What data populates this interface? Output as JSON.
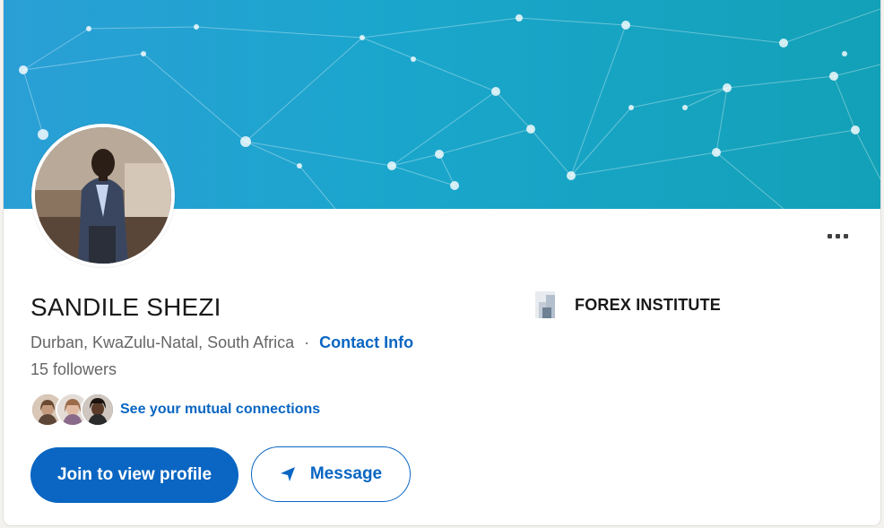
{
  "profile": {
    "name": "SANDILE SHEZI",
    "location": "Durban, KwaZulu-Natal, South Africa",
    "separator": "·",
    "contact_info_label": "Contact Info",
    "followers": "15 followers",
    "mutual_connections_label": "See your mutual connections"
  },
  "actions": {
    "join_label": "Join to view profile",
    "message_label": "Message",
    "more_icon": "ellipsis-icon"
  },
  "company": {
    "name": "FOREX INSTITUTE",
    "logo_icon": "company-logo"
  },
  "colors": {
    "accent": "#0a66c2",
    "banner_start": "#2a9fd6",
    "banner_end": "#12a1b7"
  }
}
